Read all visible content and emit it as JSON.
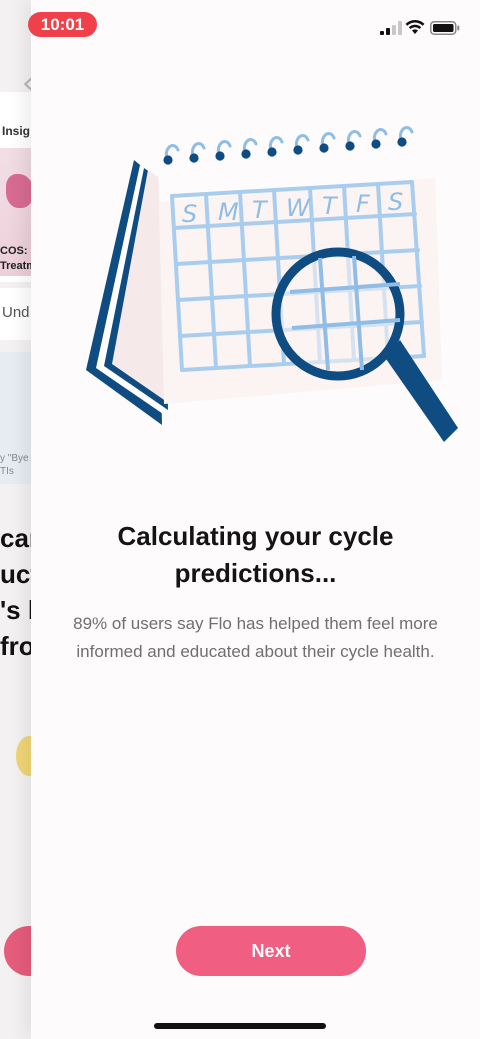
{
  "status_bar": {
    "time": "10:01",
    "icons": [
      "signal-icon",
      "wifi-icon",
      "battery-icon"
    ]
  },
  "background_screen": {
    "section_label": "Insig",
    "story_caption_line1": "COS: D",
    "story_caption_line2": "Treatm",
    "search_text": "Und",
    "card_caption_line1": "y \"Bye",
    "card_caption_line2": "TIs",
    "big_text_lines": [
      "car",
      "uct",
      "'s h",
      "fro"
    ]
  },
  "illustration": {
    "weekdays": [
      "S",
      "M",
      "T",
      "W",
      "T",
      "F",
      "S"
    ],
    "icons": [
      "calendar-icon",
      "magnifier-icon"
    ]
  },
  "main": {
    "headline": "Calculating your cycle predictions...",
    "subtext": "89% of users say Flo has helped them feel more informed and educated about their cycle health.",
    "next_label": "Next"
  },
  "colors": {
    "accent": "#f05e82",
    "status_pill": "#f0414b",
    "navy": "#0f4c81",
    "grid_blue": "#a9cdee"
  }
}
